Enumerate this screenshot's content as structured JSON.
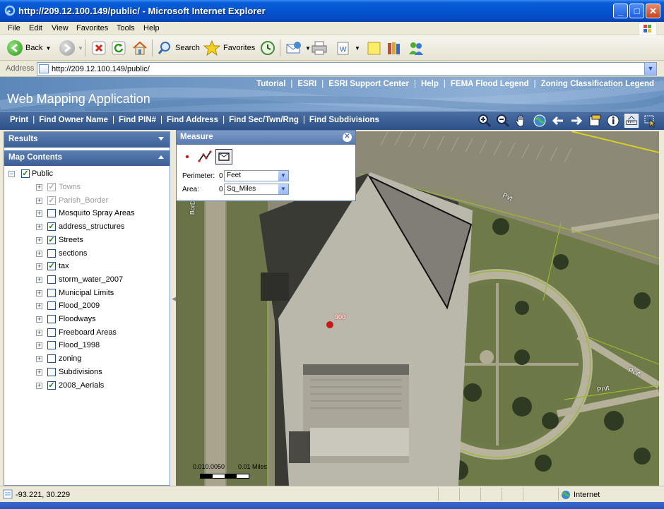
{
  "window": {
    "title": "http://209.12.100.149/public/ - Microsoft Internet Explorer",
    "buttons": [
      "_",
      "□",
      "✕"
    ]
  },
  "menu": [
    "File",
    "Edit",
    "View",
    "Favorites",
    "Tools",
    "Help"
  ],
  "toolbar": {
    "back": "Back",
    "search": "Search",
    "favorites": "Favorites"
  },
  "address": {
    "label": "Address",
    "url": "http://209.12.100.149/public/"
  },
  "app": {
    "title": "Web Mapping Application",
    "top_links": [
      "Tutorial",
      "ESRI",
      "ESRI Support Center",
      "Help",
      "FEMA Flood Legend",
      "Zoning Classification Legend"
    ],
    "nav_links": [
      "Print",
      "Find Owner Name",
      "Find PIN#",
      "Find Address",
      "Find Sec/Twn/Rng",
      "Find Subdivisions"
    ],
    "nav_tools": [
      "zoom-in-icon",
      "zoom-out-icon",
      "pan-icon",
      "full-extent-icon",
      "back-extent-icon",
      "forward-extent-icon",
      "layer-icon",
      "identify-icon",
      "measure-icon",
      "select-icon"
    ]
  },
  "panels": {
    "results": "Results",
    "map_contents": "Map Contents",
    "root": "Public",
    "layers": [
      {
        "name": "Towns",
        "checked": true,
        "disabled": true
      },
      {
        "name": "Parish_Border",
        "checked": true,
        "disabled": true
      },
      {
        "name": "Mosquito Spray Areas",
        "checked": false,
        "disabled": false
      },
      {
        "name": "address_structures",
        "checked": true,
        "disabled": false
      },
      {
        "name": "Streets",
        "checked": true,
        "disabled": false
      },
      {
        "name": "sections",
        "checked": false,
        "disabled": false
      },
      {
        "name": "tax",
        "checked": true,
        "disabled": false
      },
      {
        "name": "storm_water_2007",
        "checked": false,
        "disabled": false
      },
      {
        "name": "Municipal Limits",
        "checked": false,
        "disabled": false
      },
      {
        "name": "Flood_2009",
        "checked": false,
        "disabled": false
      },
      {
        "name": "Floodways",
        "checked": false,
        "disabled": false
      },
      {
        "name": "Freeboard Areas",
        "checked": false,
        "disabled": false
      },
      {
        "name": "Flood_1998",
        "checked": false,
        "disabled": false
      },
      {
        "name": "zoning",
        "checked": false,
        "disabled": false
      },
      {
        "name": "Subdivisions",
        "checked": false,
        "disabled": false
      },
      {
        "name": "2008_Aerials",
        "checked": true,
        "disabled": false
      }
    ]
  },
  "measure": {
    "title": "Measure",
    "perimeter_label": "Perimeter:",
    "perimeter_value": "0",
    "perimeter_unit": "Feet",
    "area_label": "Area:",
    "area_value": "0",
    "area_unit": "Sq_Miles"
  },
  "map": {
    "labels": [
      "Pvt",
      "Prvt",
      "Prvt",
      "BorDu Lac"
    ],
    "address_label": "900",
    "scale_left": "0.010.0050",
    "scale_right": "0.01 Miles"
  },
  "status": {
    "coords": "-93.221, 30.229",
    "zone": "Internet"
  },
  "colors": {
    "titlebar": "#0553d0",
    "app_header": "#7aa0cb",
    "nav": "#2d5188",
    "map_grass": "#6f7a4c"
  }
}
